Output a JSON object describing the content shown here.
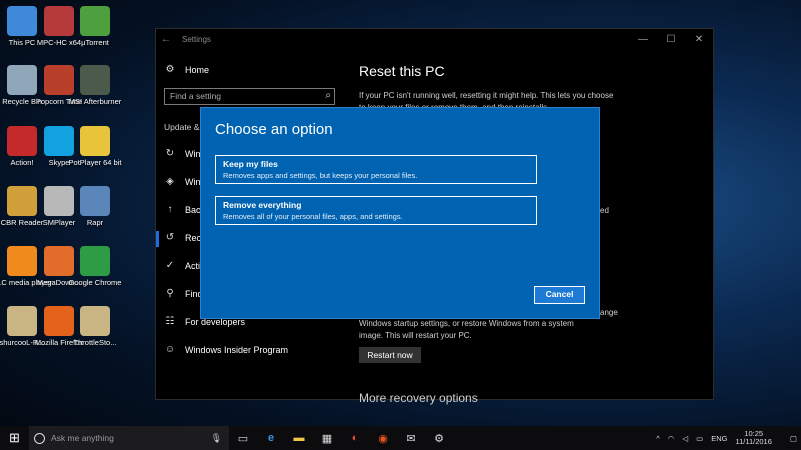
{
  "desktop": {
    "icons": [
      {
        "label": "This PC",
        "color": "#3f8ad8"
      },
      {
        "label": "MPC-HC x64",
        "color": "#b53b3b"
      },
      {
        "label": "µTorrent",
        "color": "#4ea03f"
      },
      {
        "label": "Recycle Bin",
        "color": "#8fa7b8"
      },
      {
        "label": "Popcorn Time",
        "color": "#b93f2d"
      },
      {
        "label": "MSI Afterburner",
        "color": "#4b5a4b"
      },
      {
        "label": "Action!",
        "color": "#c42a2a"
      },
      {
        "label": "Skype",
        "color": "#13a2e0"
      },
      {
        "label": "PotPlayer 64 bit",
        "color": "#e8c43a"
      },
      {
        "label": "CBR Reader",
        "color": "#d1a03a"
      },
      {
        "label": "SMPlayer",
        "color": "#b8b8b8"
      },
      {
        "label": "Rapr",
        "color": "#5b86b9"
      },
      {
        "label": "VLC media player",
        "color": "#f08a1c"
      },
      {
        "label": "MegaDown...",
        "color": "#e26d2a"
      },
      {
        "label": "Google Chrome",
        "color": "#2e9b45"
      },
      {
        "label": "shurcooL-R...",
        "color": "#c9b583"
      },
      {
        "label": "Mozilla Firefox",
        "color": "#e3621c"
      },
      {
        "label": "ThrottleSto...",
        "color": "#c9b583"
      }
    ]
  },
  "settings": {
    "title": "Settings",
    "back_glyph": "←",
    "window_controls": {
      "minimize": "—",
      "maximize": "☐",
      "close": "✕"
    },
    "nav": {
      "home": "Home",
      "search_placeholder": "Find a setting",
      "section_header": "Update &",
      "items": [
        {
          "label": "Wind",
          "icon": "refresh-icon"
        },
        {
          "label": "Wind",
          "icon": "shield-icon"
        },
        {
          "label": "Back",
          "icon": "backup-icon"
        },
        {
          "label": "Reco",
          "icon": "recovery-icon"
        },
        {
          "label": "Activ",
          "icon": "activation-icon"
        },
        {
          "label": "Find",
          "icon": "find-device-icon"
        },
        {
          "label": "For developers",
          "icon": "developer-icon"
        },
        {
          "label": "Windows Insider Program",
          "icon": "insider-icon"
        }
      ]
    },
    "main": {
      "reset_title": "Reset this PC",
      "reset_desc": "If your PC isn't running well, resetting it might help. This lets you choose to keep your files or remove them, and then reinstalls",
      "fragment_ed": "ed",
      "fragment_ange": "ange",
      "advanced_desc": "Windows startup settings, or restore Windows from a system image. This will restart your PC.",
      "restart_now": "Restart now",
      "more_recovery": "More recovery options"
    }
  },
  "dialog": {
    "title": "Choose an option",
    "options": [
      {
        "title": "Keep my files",
        "subtitle": "Removes apps and settings, but keeps your personal files."
      },
      {
        "title": "Remove everything",
        "subtitle": "Removes all of your personal files, apps, and settings."
      }
    ],
    "cancel": "Cancel"
  },
  "taskbar": {
    "search_placeholder": "Ask me anything",
    "language": "ENG",
    "time": "10:25",
    "date": "11/11/2016"
  }
}
